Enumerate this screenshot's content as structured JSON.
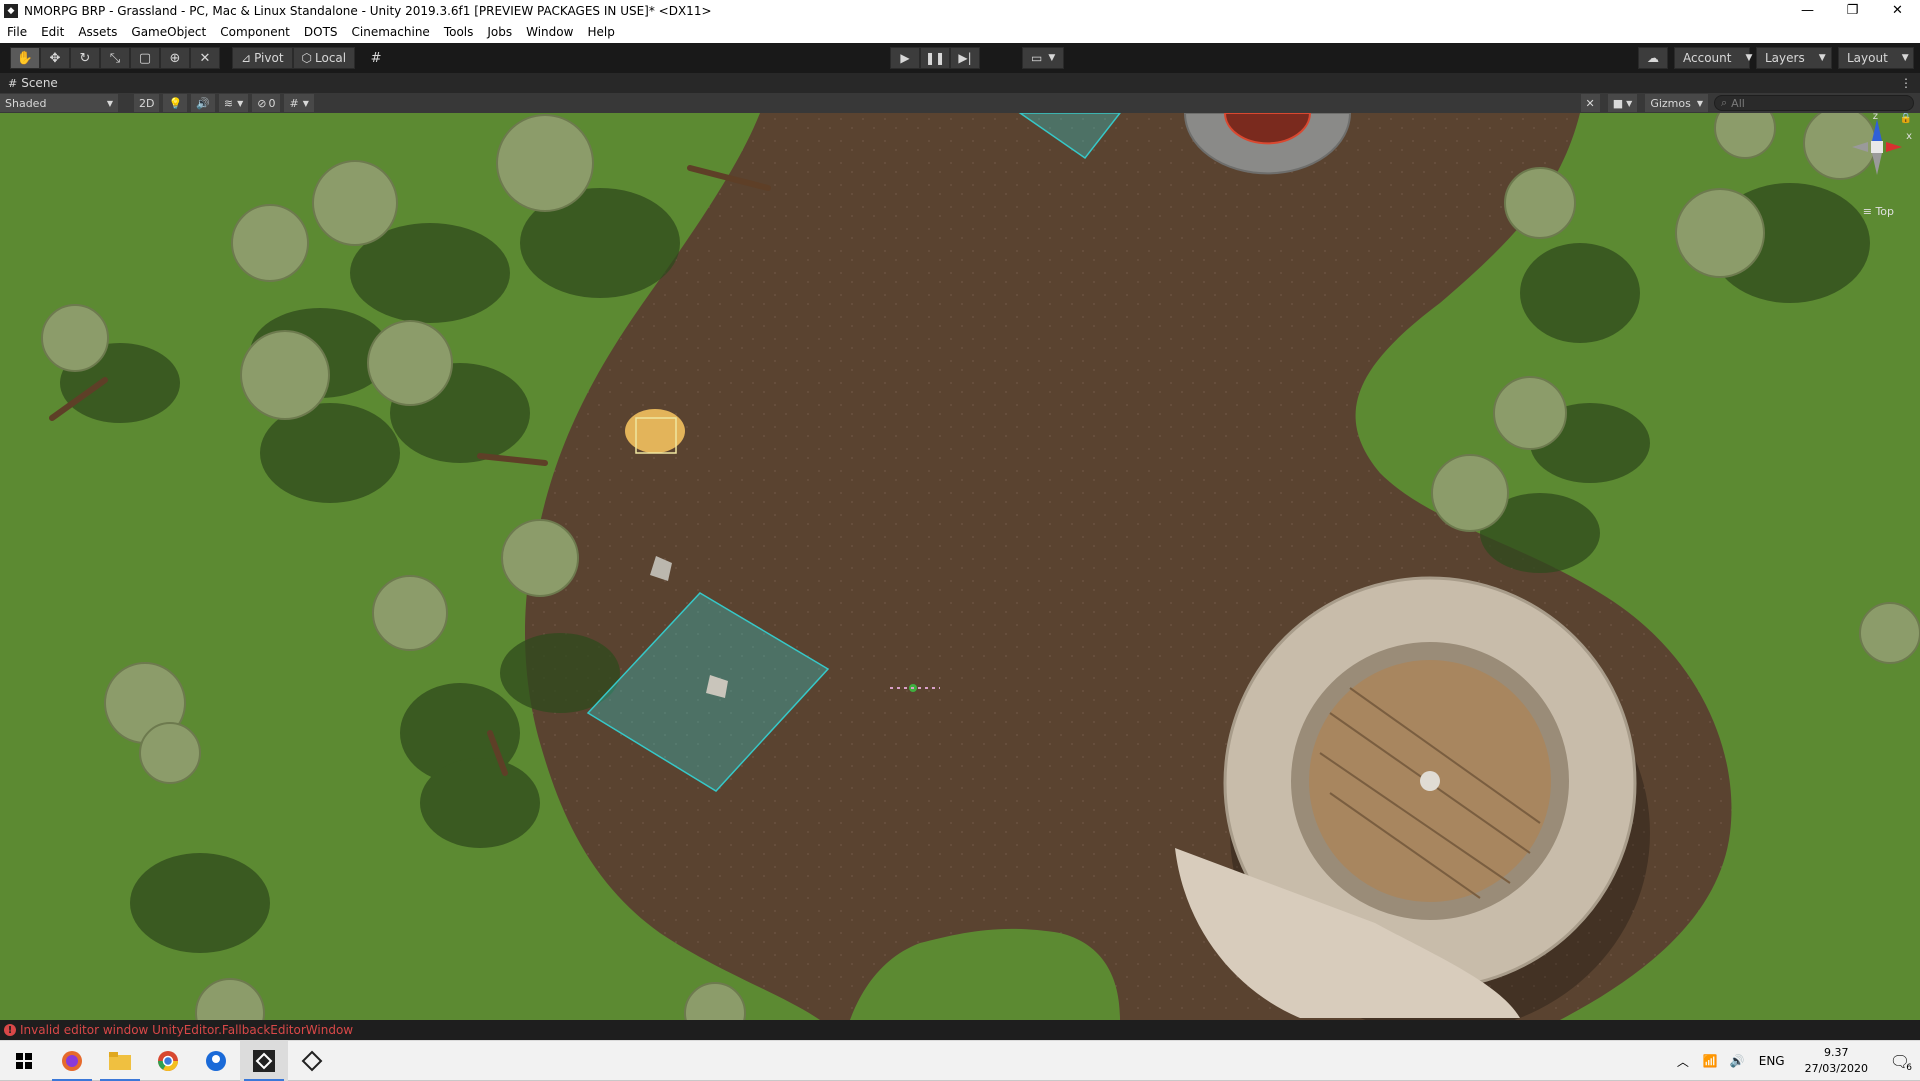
{
  "window": {
    "title": "NMORPG BRP - Grassland - PC, Mac & Linux Standalone - Unity 2019.3.6f1 [PREVIEW PACKAGES IN USE]* <DX11>",
    "minimize_icon": "minimize-icon",
    "maximize_icon": "restore-icon",
    "close_icon": "close-icon"
  },
  "menu": [
    "File",
    "Edit",
    "Assets",
    "GameObject",
    "Component",
    "DOTS",
    "Cinemachine",
    "Tools",
    "Jobs",
    "Window",
    "Help"
  ],
  "toolbar": {
    "pivot_label": "Pivot",
    "local_label": "Local",
    "account_label": "Account",
    "layers_label": "Layers",
    "layout_label": "Layout"
  },
  "scene": {
    "tab_label": "Scene",
    "shading_mode": "Shaded",
    "mode_2d": "2D",
    "hidden_count": "0",
    "gizmos_label": "Gizmos",
    "search_placeholder": "All",
    "view_label": "Top",
    "axis_x": "x",
    "axis_z": "z"
  },
  "status": {
    "error_message": "Invalid editor window UnityEditor.FallbackEditorWindow"
  },
  "taskbar": {
    "language": "ENG",
    "time": "9.37",
    "date": "27/03/2020",
    "notification_count": "6"
  },
  "colors": {
    "grass": "#5c8a32",
    "dirt": "#5a4330",
    "trigger_zone": "#36c8c8",
    "error": "#d94848",
    "editor_dark": "#191919"
  }
}
